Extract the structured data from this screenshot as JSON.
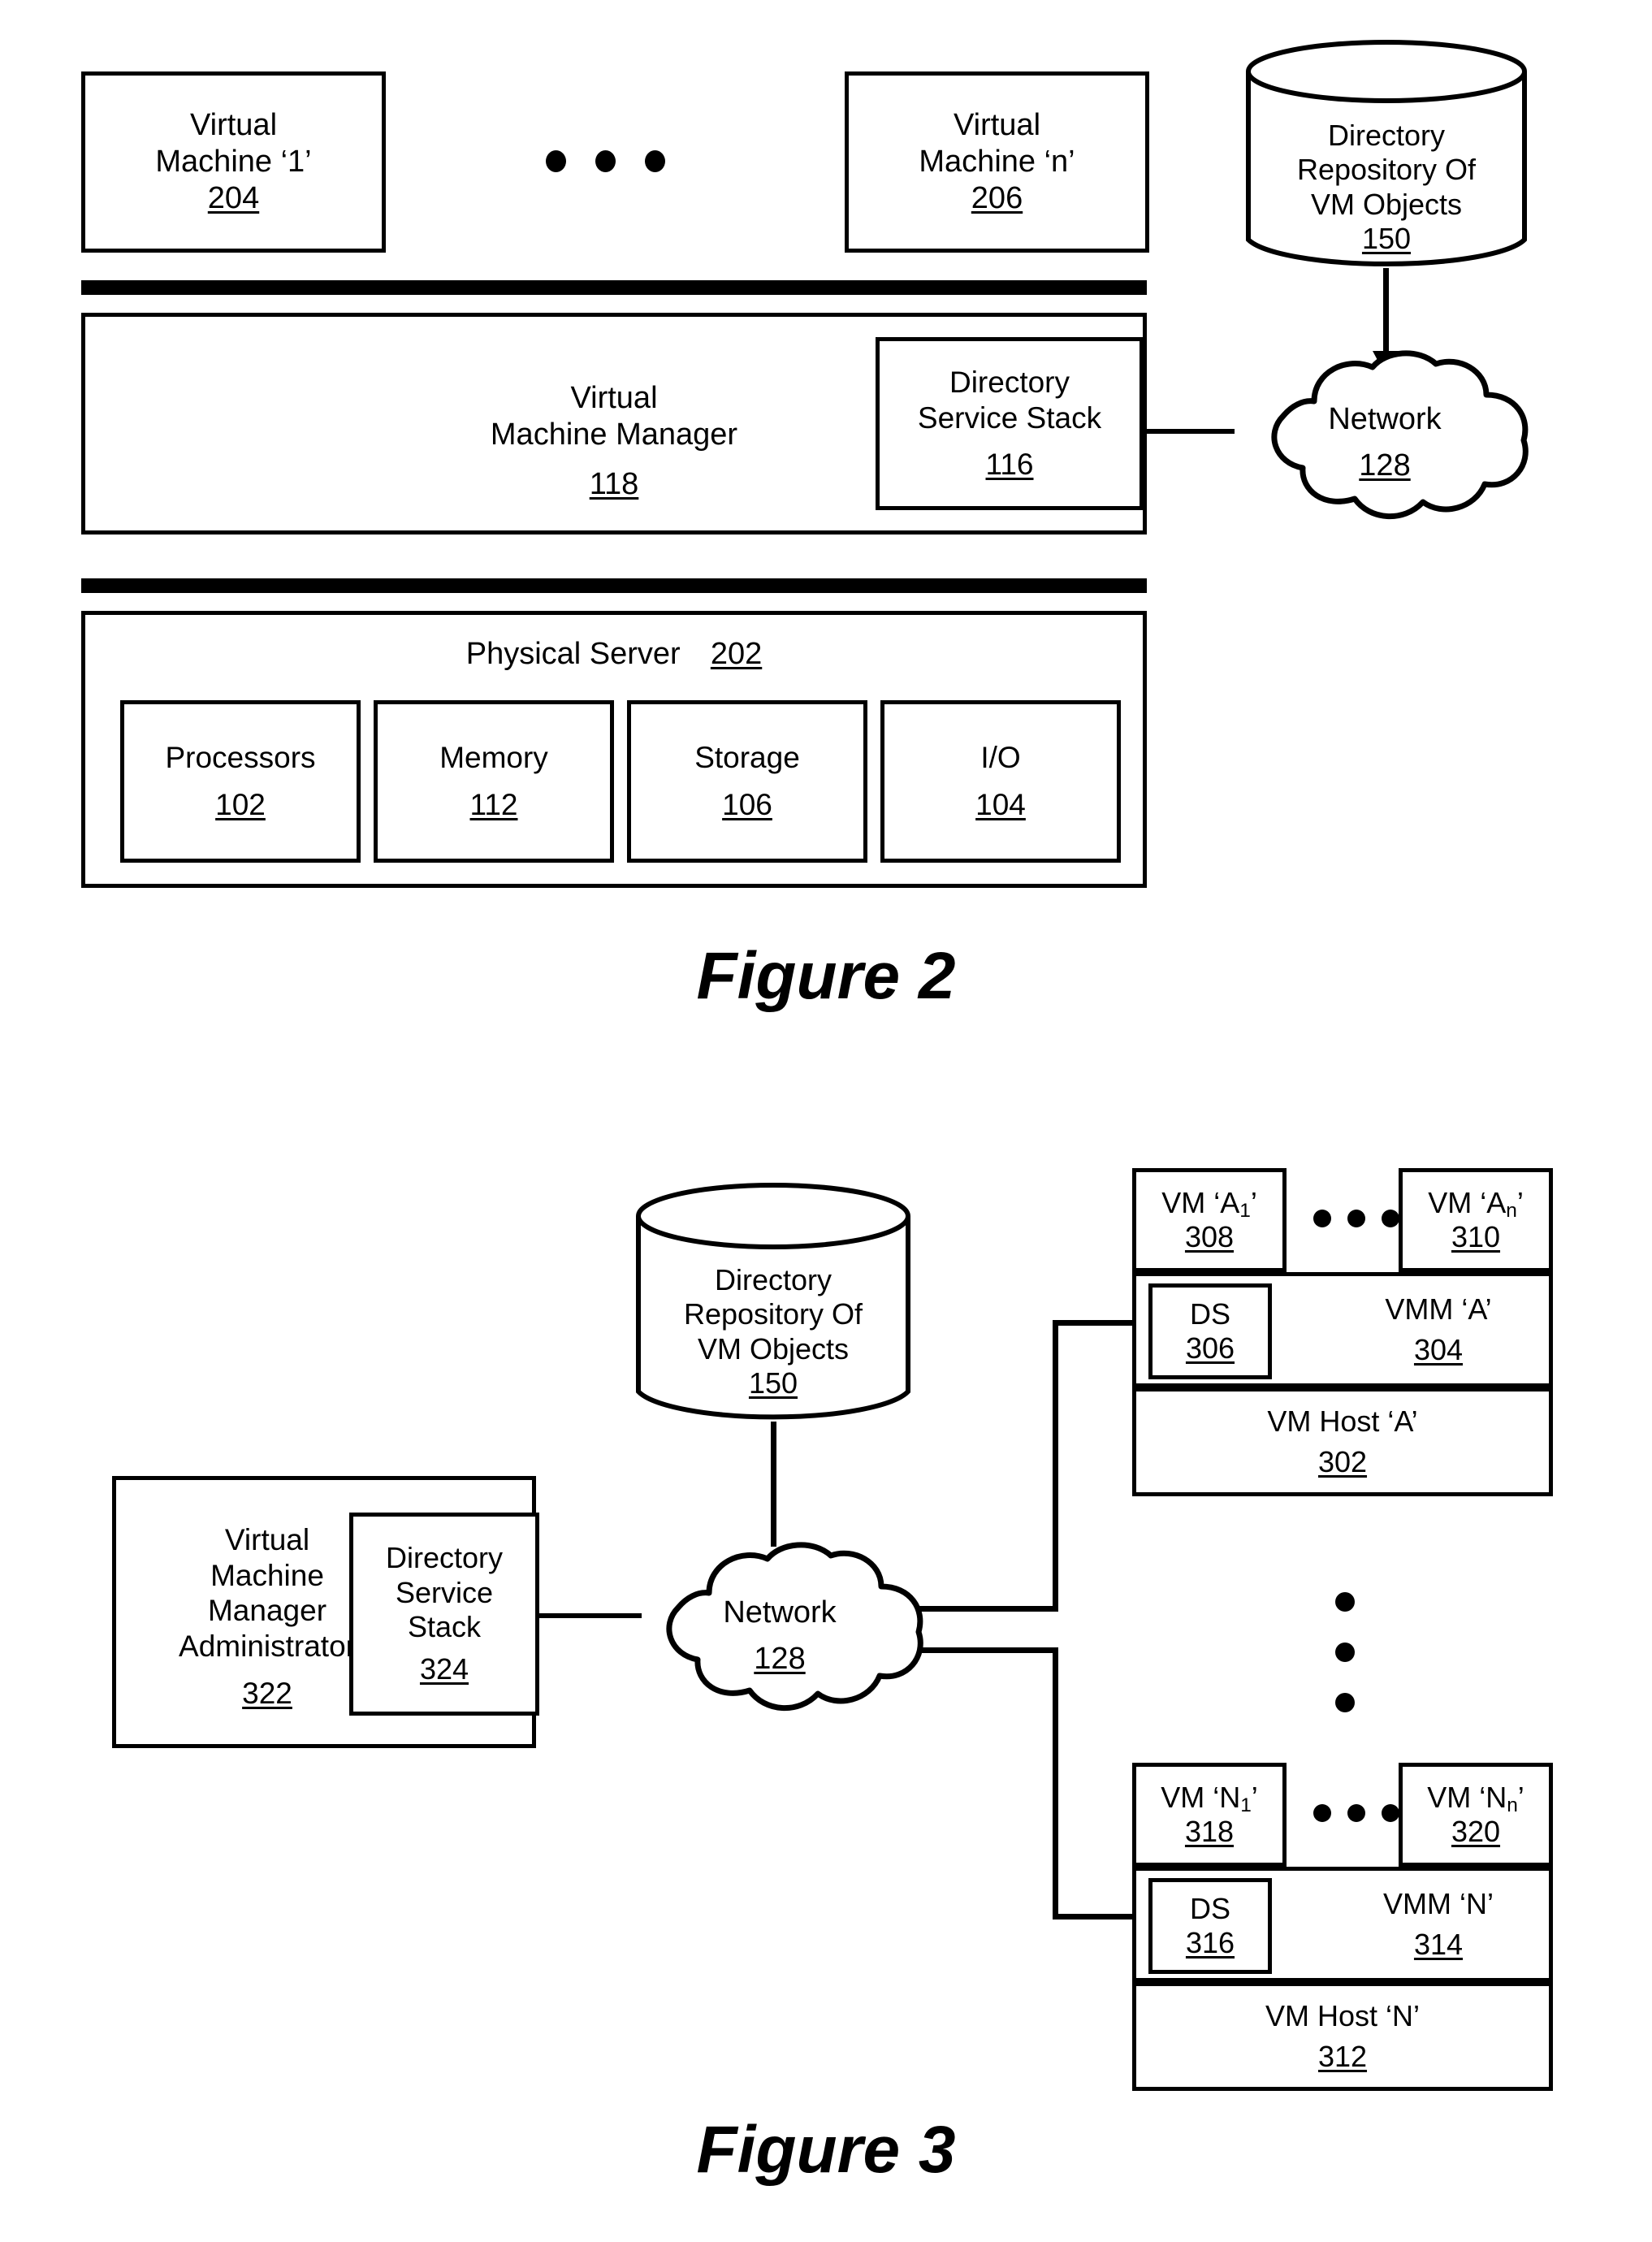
{
  "figure2": {
    "caption": "Figure 2",
    "vm1": {
      "line1": "Virtual",
      "line2": "Machine ‘1’",
      "ref": "204"
    },
    "vmn": {
      "line1": "Virtual",
      "line2": "Machine ‘n’",
      "ref": "206"
    },
    "vmm": {
      "line1": "Virtual",
      "line2": "Machine Manager",
      "ref": "118"
    },
    "dss": {
      "line1": "Directory",
      "line2": "Service Stack",
      "ref": "116"
    },
    "repository": {
      "line1": "Directory",
      "line2": "Repository Of",
      "line3": "VM Objects",
      "ref": "150"
    },
    "network": {
      "label": "Network",
      "ref": "128"
    },
    "physical_server": {
      "label": "Physical Server",
      "ref": "202"
    },
    "components": [
      {
        "label": "Processors",
        "ref": "102"
      },
      {
        "label": "Memory",
        "ref": "112"
      },
      {
        "label": "Storage",
        "ref": "106"
      },
      {
        "label": "I/O",
        "ref": "104"
      }
    ]
  },
  "figure3": {
    "caption": "Figure 3",
    "repository": {
      "line1": "Directory",
      "line2": "Repository Of",
      "line3": "VM Objects",
      "ref": "150"
    },
    "network": {
      "label": "Network",
      "ref": "128"
    },
    "admin": {
      "line1": "Virtual",
      "line2": "Machine",
      "line3": "Manager",
      "line4": "Administrator",
      "ref": "322"
    },
    "admin_dss": {
      "line1": "Directory",
      "line2": "Service",
      "line3": "Stack",
      "ref": "324"
    },
    "host_a": {
      "vm_first": {
        "label": "VM ‘A",
        "sub": "1",
        "label_end": "’",
        "ref": "308"
      },
      "vm_last": {
        "label": "VM ‘A",
        "sub": "n",
        "label_end": "’",
        "ref": "310"
      },
      "ds": {
        "label": "DS",
        "ref": "306"
      },
      "vmm": {
        "label": "VMM ‘A’",
        "ref": "304"
      },
      "host": {
        "label": "VM Host ‘A’",
        "ref": "302"
      }
    },
    "host_n": {
      "vm_first": {
        "label": "VM ‘N",
        "sub": "1",
        "label_end": "’",
        "ref": "318"
      },
      "vm_last": {
        "label": "VM ‘N",
        "sub": "n",
        "label_end": "’",
        "ref": "320"
      },
      "ds": {
        "label": "DS",
        "ref": "316"
      },
      "vmm": {
        "label": "VMM ‘N’",
        "ref": "314"
      },
      "host": {
        "label": "VM Host ‘N’",
        "ref": "312"
      }
    }
  },
  "colors": {
    "ink": "#000000",
    "paper": "#ffffff"
  }
}
